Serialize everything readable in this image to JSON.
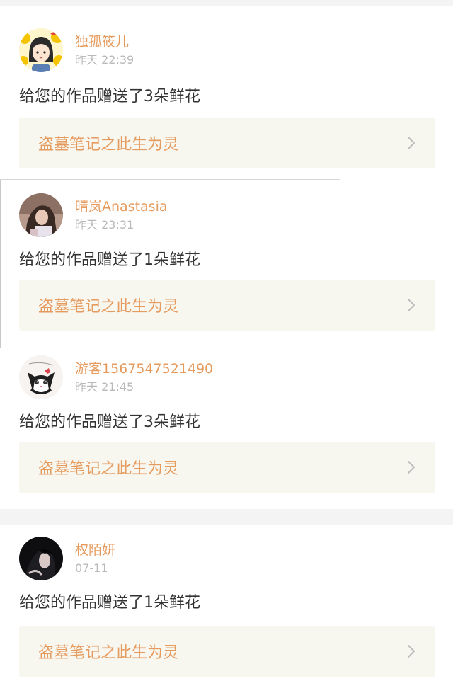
{
  "notifications": [
    {
      "user": "独孤筱儿",
      "time": "昨天 22:39",
      "message": "给您的作品赠送了3朵鲜花",
      "work": "盗墓笔记之此生为灵",
      "avatar": "cartoon-girl-avatar"
    },
    {
      "user": "晴岚Anastasia",
      "time": "昨天 23:31",
      "message": "给您的作品赠送了1朵鲜花",
      "work": "盗墓笔记之此生为灵",
      "avatar": "photo-avatar"
    },
    {
      "user": "游客1567547521490",
      "time": "昨天 21:45",
      "message": "给您的作品赠送了3朵鲜花",
      "work": "盗墓笔记之此生为灵",
      "avatar": "cat-avatar"
    },
    {
      "user": "权陌妍",
      "time": "07-11",
      "message": "给您的作品赠送了1朵鲜花",
      "work": "盗墓笔记之此生为灵",
      "avatar": "dark-photo-avatar"
    }
  ],
  "colors": {
    "accent": "#e69b5e",
    "text": "#333333",
    "muted": "#b9b9b9",
    "link_bg": "#f7f6ef",
    "page_bg": "#f4f4f4"
  }
}
